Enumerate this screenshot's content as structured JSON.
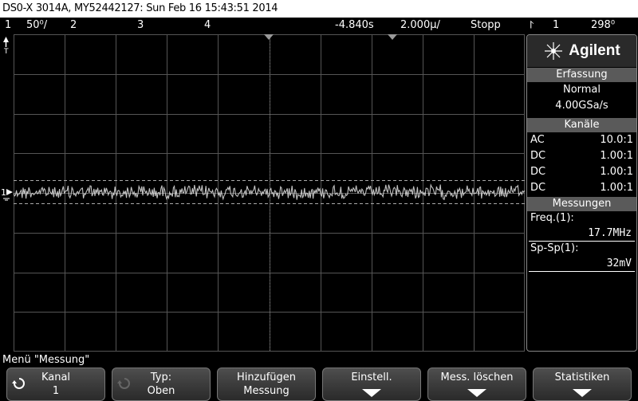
{
  "titlebar": {
    "text": "DS0-X 3014A, MY52442127: Sun Feb 16 15:43:51 2014"
  },
  "status": {
    "ch1": "1",
    "ch1_scale": "50⁰/",
    "ch2": "2",
    "ch3": "3",
    "ch4": "4",
    "delay": "-4.840s",
    "timebase": "2.000µ/",
    "run_state": "Stopp",
    "trig_symbol": "⨡",
    "trig_source": "1",
    "trig_level": "298⁰"
  },
  "panel": {
    "logo": "Agilent",
    "acq": {
      "header": "Erfassung",
      "mode": "Normal",
      "rate": "4.00GSa/s"
    },
    "channels": {
      "header": "Kanäle",
      "rows": [
        {
          "coupling": "AC",
          "ratio": "10.0:1"
        },
        {
          "coupling": "DC",
          "ratio": "1.00:1"
        },
        {
          "coupling": "DC",
          "ratio": "1.00:1"
        },
        {
          "coupling": "DC",
          "ratio": "1.00:1"
        }
      ]
    },
    "measurements": {
      "header": "Messungen",
      "items": [
        {
          "label": "Freq.(1):",
          "value": "17.7MHz"
        },
        {
          "label": "Sp-Sp(1):",
          "value": "32mV"
        }
      ]
    }
  },
  "menu": {
    "title": "Menü \"Messung\""
  },
  "softkeys": [
    {
      "line1": "Kanal",
      "line2": "1"
    },
    {
      "line1": "Typ:",
      "line2": "Oben"
    },
    {
      "line1": "Hinzufügen",
      "line2": "Messung"
    },
    {
      "line1": "Einstell.",
      "line2": ""
    },
    {
      "line1": "Mess. löschen",
      "line2": ""
    },
    {
      "line1": "Statistiken",
      "line2": ""
    }
  ],
  "colors": {
    "grid": "#555555",
    "trace": "#d8d8d8",
    "panel_header": "#5a5a5a",
    "background": "#000000"
  },
  "icons": {
    "knob": "rotary-knob-icon",
    "trigger_marker": "triangle-down-icon",
    "ground": "ground-icon"
  }
}
